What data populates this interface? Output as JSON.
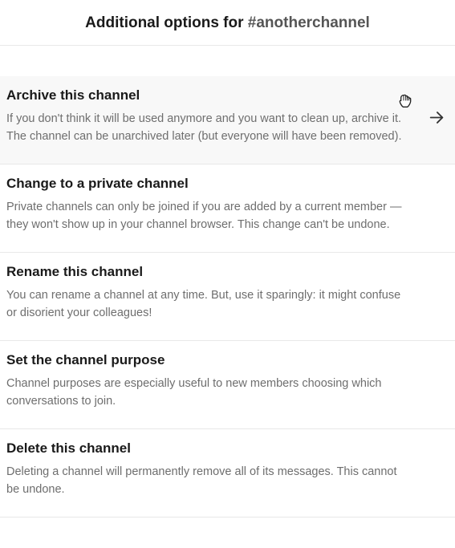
{
  "header": {
    "prefix": "Additional options for ",
    "channel": "#anotherchannel"
  },
  "options": [
    {
      "title": "Archive this channel",
      "description": "If you don't think it will be used anymore and you want to clean up, archive it. The channel can be unarchived later (but everyone will have been removed).",
      "highlighted": true,
      "showArrow": true,
      "showCursor": true
    },
    {
      "title": "Change to a private channel",
      "description": "Private channels can only be joined if you are added by a current member — they won't show up in your channel browser. This change can't be undone.",
      "highlighted": false,
      "showArrow": false,
      "showCursor": false
    },
    {
      "title": "Rename this channel",
      "description": "You can rename a channel at any time. But, use it sparingly: it might confuse or disorient your colleagues!",
      "highlighted": false,
      "showArrow": false,
      "showCursor": false
    },
    {
      "title": "Set the channel purpose",
      "description": "Channel purposes are especially useful to new members choosing which conversations to join.",
      "highlighted": false,
      "showArrow": false,
      "showCursor": false
    },
    {
      "title": "Delete this channel",
      "description": "Deleting a channel will permanently remove all of its messages. This cannot be undone.",
      "highlighted": false,
      "showArrow": false,
      "showCursor": false
    }
  ]
}
